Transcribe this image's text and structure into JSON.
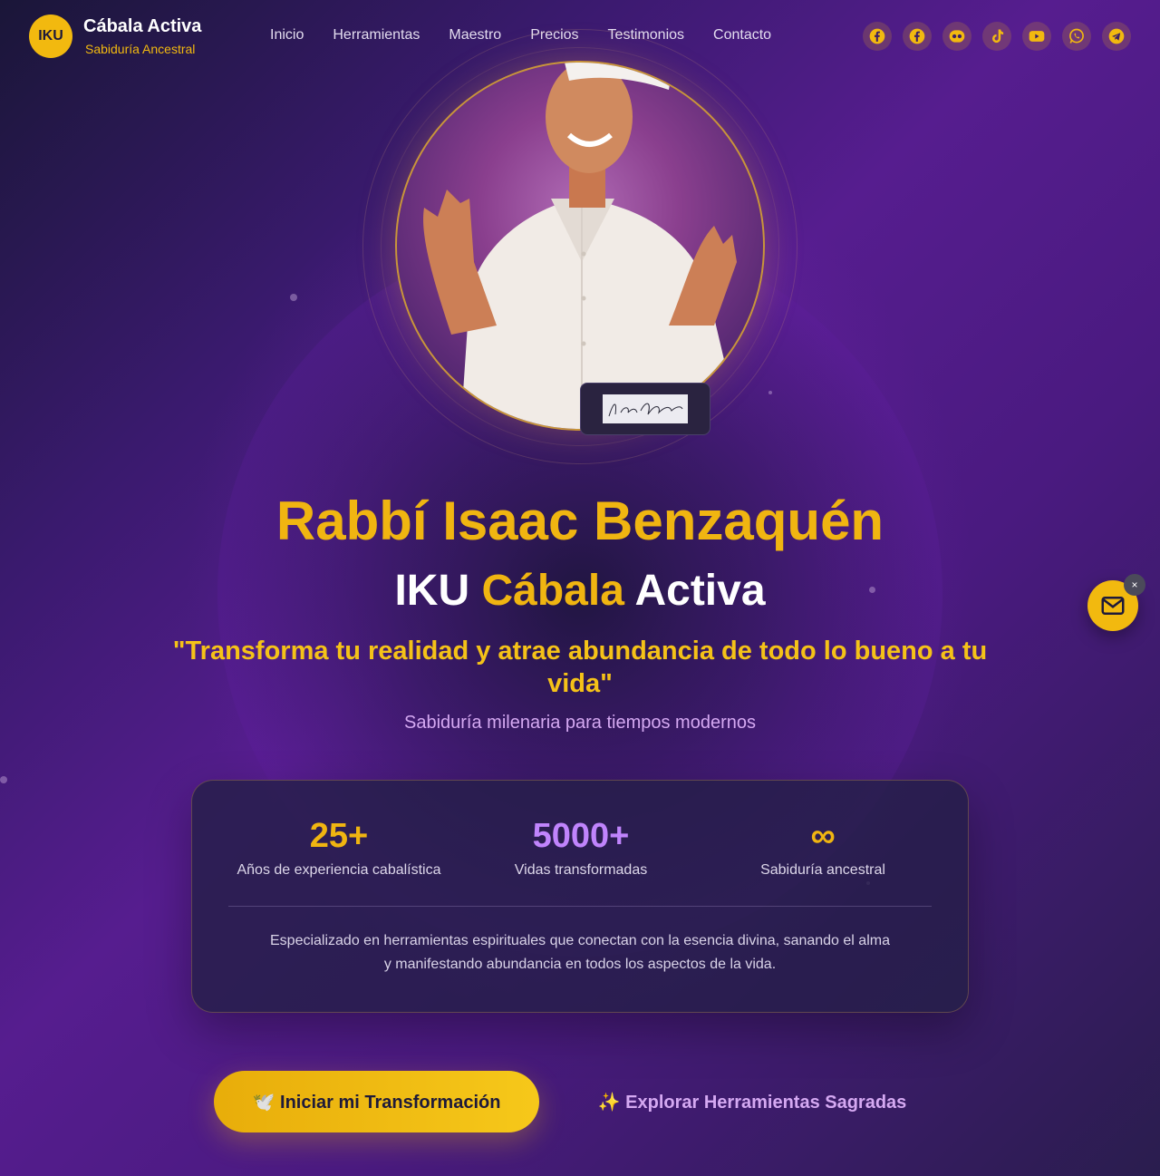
{
  "header": {
    "logo_text": "IKU",
    "brand_name": "Cábala Activa",
    "brand_sub": "Sabiduría Ancestral",
    "nav": [
      {
        "label": "Inicio"
      },
      {
        "label": "Herramientas"
      },
      {
        "label": "Maestro"
      },
      {
        "label": "Precios"
      },
      {
        "label": "Testimonios"
      },
      {
        "label": "Contacto"
      }
    ],
    "socials": [
      "facebook-icon",
      "facebook-icon",
      "flickr-icon",
      "tiktok-icon",
      "youtube-icon",
      "whatsapp-icon",
      "telegram-icon"
    ]
  },
  "hero": {
    "name": "Rabbí Isaac Benzaquén",
    "subtitle_pre": "IKU",
    "subtitle_gold": "Cábala",
    "subtitle_post": "Activa",
    "tagline": "\"Transforma tu realidad y atrae abundancia de todo lo bueno a tu vida\"",
    "lead": "Sabiduría milenaria para tiempos modernos",
    "signature": "Isaac Benzaquén"
  },
  "stats": [
    {
      "value": "25+",
      "label": "Años de experiencia cabalística",
      "color": "#f0b511"
    },
    {
      "value": "5000+",
      "label": "Vidas transformadas",
      "color": "#c084fc"
    },
    {
      "value": "∞",
      "label": "Sabiduría ancestral",
      "color": "#f0b511"
    }
  ],
  "card_text": "Especializado en herramientas espirituales que conectan con la esencia divina, sanando el alma y manifestando abundancia en todos los aspectos de la vida.",
  "buttons": {
    "primary": "🕊️ Iniciar mi Transformación",
    "secondary": "✨ Explorar Herramientas Sagradas"
  },
  "fab": {
    "close": "×"
  },
  "colors": {
    "gold": "#f0b511",
    "purple": "#561d8f",
    "lavender": "#d5a9f2"
  }
}
